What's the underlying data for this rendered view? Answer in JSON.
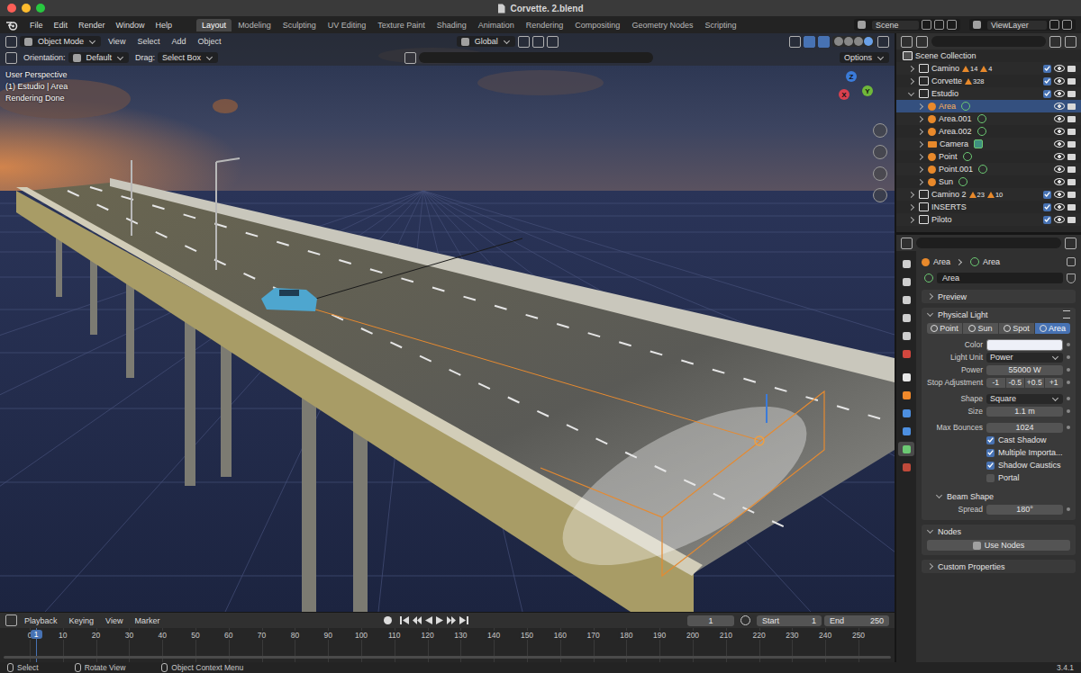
{
  "window": {
    "title": "Corvette. 2.blend"
  },
  "menu": [
    "File",
    "Edit",
    "Render",
    "Window",
    "Help"
  ],
  "workspaces": [
    {
      "label": "Layout",
      "selected": true
    },
    {
      "label": "Modeling",
      "selected": false
    },
    {
      "label": "Sculpting",
      "selected": false
    },
    {
      "label": "UV Editing",
      "selected": false
    },
    {
      "label": "Texture Paint",
      "selected": false
    },
    {
      "label": "Shading",
      "selected": false
    },
    {
      "label": "Animation",
      "selected": false
    },
    {
      "label": "Rendering",
      "selected": false
    },
    {
      "label": "Compositing",
      "selected": false
    },
    {
      "label": "Geometry Nodes",
      "selected": false
    },
    {
      "label": "Scripting",
      "selected": false
    }
  ],
  "scene": "Scene",
  "view_layer": "ViewLayer",
  "viewport": {
    "mode": "Object Mode",
    "menus": [
      "View",
      "Select",
      "Add",
      "Object"
    ],
    "orientation": "Global",
    "tool_row": {
      "orientation_label": "Orientation:",
      "orientation": "Default",
      "drag_label": "Drag:",
      "drag": "Select Box",
      "options": "Options"
    },
    "overlay": [
      "User Perspective",
      "(1) Estudio | Area",
      "Rendering Done"
    ],
    "axes": [
      {
        "label": "Z",
        "color": "#3b7bd9"
      },
      {
        "label": "Y",
        "color": "#6fb83a"
      },
      {
        "label": "X",
        "color": "#d9404f"
      }
    ]
  },
  "outliner": {
    "root": "Scene Collection",
    "collections": [
      {
        "name": "Camino",
        "expanded": false,
        "selected": false,
        "checked": true,
        "visible": true,
        "renderable": true,
        "badges": [
          "14",
          "4"
        ],
        "objects": []
      },
      {
        "name": "Corvette",
        "expanded": false,
        "selected": false,
        "checked": true,
        "visible": true,
        "renderable": true,
        "badges": [
          "328"
        ],
        "objects": []
      },
      {
        "name": "Estudio",
        "expanded": true,
        "selected": false,
        "checked": true,
        "visible": true,
        "renderable": true,
        "badges": [],
        "objects": [
          {
            "name": "Area",
            "kind": "light",
            "expanded": false,
            "selected": true,
            "visible": true,
            "renderable": true
          },
          {
            "name": "Area.001",
            "kind": "light",
            "expanded": false,
            "selected": false,
            "visible": true,
            "renderable": true
          },
          {
            "name": "Area.002",
            "kind": "light",
            "expanded": false,
            "selected": false,
            "visible": true,
            "renderable": true
          },
          {
            "name": "Camera",
            "kind": "camera",
            "expanded": false,
            "selected": false,
            "visible": true,
            "renderable": true
          },
          {
            "name": "Point",
            "kind": "light",
            "expanded": false,
            "selected": false,
            "visible": true,
            "renderable": true
          },
          {
            "name": "Point.001",
            "kind": "light",
            "expanded": false,
            "selected": false,
            "visible": true,
            "renderable": true
          },
          {
            "name": "Sun",
            "kind": "light",
            "expanded": false,
            "selected": false,
            "visible": true,
            "renderable": true
          }
        ]
      },
      {
        "name": "Camino 2",
        "expanded": false,
        "selected": false,
        "checked": true,
        "visible": true,
        "renderable": true,
        "badges": [
          "23",
          "10"
        ],
        "objects": []
      },
      {
        "name": "INSERTS",
        "expanded": false,
        "selected": false,
        "checked": true,
        "visible": true,
        "renderable": true,
        "badges": [],
        "objects": []
      },
      {
        "name": "Piloto",
        "expanded": false,
        "selected": false,
        "checked": true,
        "visible": true,
        "renderable": true,
        "badges": [],
        "objects": []
      }
    ]
  },
  "properties": {
    "tabs": [
      {
        "selected": false
      },
      {
        "selected": false
      },
      {
        "selected": false
      },
      {
        "selected": false
      },
      {
        "selected": false
      },
      {
        "selected": false
      },
      {
        "selected": false
      },
      {
        "selected": false
      },
      {
        "selected": false
      },
      {
        "selected": false
      },
      {
        "selected": true
      },
      {
        "selected": false
      }
    ],
    "breadcrumb": [
      "Area",
      "Area"
    ],
    "datablock": "Area",
    "preview": {
      "label": "Preview",
      "expanded": false
    },
    "physical_light": {
      "label": "Physical Light",
      "expanded": true,
      "types": [
        {
          "label": "Point",
          "selected": false
        },
        {
          "label": "Sun",
          "selected": false
        },
        {
          "label": "Spot",
          "selected": false
        },
        {
          "label": "Area",
          "selected": true
        }
      ],
      "groups": [
        [
          {
            "kind": "color",
            "label": "Color",
            "swatch": "#eef0f8"
          },
          {
            "kind": "dropdown",
            "label": "Light Unit",
            "value": "Power"
          },
          {
            "kind": "number",
            "label": "Power",
            "value": "55000 W"
          },
          {
            "kind": "buttons",
            "label": "Stop Adjustment",
            "buttons": [
              "-1",
              "-0.5",
              "+0.5",
              "+1"
            ]
          }
        ],
        [
          {
            "kind": "dropdown",
            "label": "Shape",
            "value": "Square"
          },
          {
            "kind": "number",
            "label": "Size",
            "value": "1.1 m"
          }
        ],
        [
          {
            "kind": "number",
            "label": "Max Bounces",
            "value": "1024"
          },
          {
            "kind": "checkbox",
            "label": "Cast Shadow",
            "checked": true
          },
          {
            "kind": "checkbox",
            "label": "Multiple Importa...",
            "checked": true
          },
          {
            "kind": "checkbox",
            "label": "Shadow Caustics",
            "checked": true
          },
          {
            "kind": "checkbox",
            "label": "Portal",
            "checked": false
          }
        ]
      ]
    },
    "beam_shape": {
      "label": "Beam Shape",
      "expanded": true,
      "spread_label": "Spread",
      "spread": "180°"
    },
    "nodes": {
      "label": "Nodes",
      "expanded": true,
      "button": "Use Nodes"
    },
    "custom_properties": {
      "label": "Custom Properties",
      "expanded": false
    }
  },
  "timeline": {
    "menus": [
      "Playback",
      "Keying",
      "View",
      "Marker"
    ],
    "current_frame": "1",
    "start_label": "Start",
    "start": "1",
    "end_label": "End",
    "end": "250",
    "ticks": [
      "0",
      "10",
      "20",
      "30",
      "40",
      "50",
      "60",
      "70",
      "80",
      "90",
      "100",
      "110",
      "120",
      "130",
      "140",
      "150",
      "160",
      "170",
      "180",
      "190",
      "200",
      "210",
      "220",
      "230",
      "240",
      "250"
    ],
    "playhead": "1"
  },
  "status_bar": {
    "items": [
      {
        "label": "Select"
      },
      {
        "label": "Rotate View"
      },
      {
        "label": "Object Context Menu"
      }
    ],
    "version": "3.4.1"
  }
}
